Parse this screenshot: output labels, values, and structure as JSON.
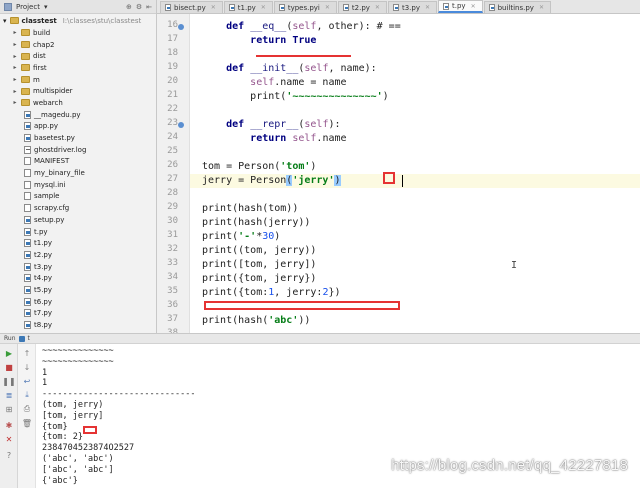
{
  "project": {
    "header_label": "Project",
    "root_name": "classtest",
    "root_path": "I:\\classes\\stu\\classtest",
    "items": [
      {
        "label": "build",
        "type": "folder"
      },
      {
        "label": "chap2",
        "type": "folder"
      },
      {
        "label": "dist",
        "type": "folder"
      },
      {
        "label": "first",
        "type": "folder"
      },
      {
        "label": "m",
        "type": "folder"
      },
      {
        "label": "multispider",
        "type": "folder"
      },
      {
        "label": "webarch",
        "type": "folder"
      },
      {
        "label": "__magedu.py",
        "type": "py"
      },
      {
        "label": "app.py",
        "type": "py"
      },
      {
        "label": "basetest.py",
        "type": "py"
      },
      {
        "label": "ghostdriver.log",
        "type": "log"
      },
      {
        "label": "MANIFEST",
        "type": "file"
      },
      {
        "label": "my_binary_file",
        "type": "file"
      },
      {
        "label": "mysql.ini",
        "type": "file"
      },
      {
        "label": "sample",
        "type": "file"
      },
      {
        "label": "scrapy.cfg",
        "type": "file"
      },
      {
        "label": "setup.py",
        "type": "py"
      },
      {
        "label": "t.py",
        "type": "py"
      },
      {
        "label": "t1.py",
        "type": "py"
      },
      {
        "label": "t2.py",
        "type": "py"
      },
      {
        "label": "t3.py",
        "type": "py"
      },
      {
        "label": "t4.py",
        "type": "py"
      },
      {
        "label": "t5.py",
        "type": "py"
      },
      {
        "label": "t6.py",
        "type": "py"
      },
      {
        "label": "t7.py",
        "type": "py"
      },
      {
        "label": "t8.py",
        "type": "py"
      }
    ]
  },
  "tabs": [
    {
      "label": "bisect.py",
      "active": false
    },
    {
      "label": "t1.py",
      "active": false
    },
    {
      "label": "types.pyi",
      "active": false
    },
    {
      "label": "t2.py",
      "active": false
    },
    {
      "label": "t3.py",
      "active": false
    },
    {
      "label": "t.py",
      "active": true
    },
    {
      "label": "builtins.py",
      "active": false
    }
  ],
  "editor": {
    "line_numbers": [
      "16",
      "17",
      "18",
      "19",
      "20",
      "21",
      "22",
      "23",
      "24",
      "25",
      "26",
      "27",
      "28",
      "29",
      "30",
      "31",
      "32",
      "33",
      "34",
      "35",
      "36",
      "37",
      "38"
    ],
    "lines": [
      [
        {
          "t": "    ",
          "c": "plain"
        },
        {
          "t": "def ",
          "c": "kw"
        },
        {
          "t": "__eq__",
          "c": "fn"
        },
        {
          "t": "(",
          "c": "plain"
        },
        {
          "t": "self",
          "c": "self"
        },
        {
          "t": ", other): # ==",
          "c": "plain"
        }
      ],
      [
        {
          "t": "        ",
          "c": "plain"
        },
        {
          "t": "return ",
          "c": "kw"
        },
        {
          "t": "True",
          "c": "kw"
        }
      ],
      [
        {
          "t": "",
          "c": "plain"
        }
      ],
      [
        {
          "t": "    ",
          "c": "plain"
        },
        {
          "t": "def ",
          "c": "kw"
        },
        {
          "t": "__init__",
          "c": "fn"
        },
        {
          "t": "(",
          "c": "plain"
        },
        {
          "t": "self",
          "c": "self"
        },
        {
          "t": ", name):",
          "c": "plain"
        }
      ],
      [
        {
          "t": "        ",
          "c": "plain"
        },
        {
          "t": "self",
          "c": "self"
        },
        {
          "t": ".name = name",
          "c": "plain"
        }
      ],
      [
        {
          "t": "        ",
          "c": "plain"
        },
        {
          "t": "print",
          "c": "plain"
        },
        {
          "t": "(",
          "c": "plain"
        },
        {
          "t": "'~~~~~~~~~~~~~~'",
          "c": "str"
        },
        {
          "t": ")",
          "c": "plain"
        }
      ],
      [
        {
          "t": "",
          "c": "plain"
        }
      ],
      [
        {
          "t": "    ",
          "c": "plain"
        },
        {
          "t": "def ",
          "c": "kw"
        },
        {
          "t": "__repr__",
          "c": "fn"
        },
        {
          "t": "(",
          "c": "plain"
        },
        {
          "t": "self",
          "c": "self"
        },
        {
          "t": "):",
          "c": "plain"
        }
      ],
      [
        {
          "t": "        ",
          "c": "plain"
        },
        {
          "t": "return ",
          "c": "kw"
        },
        {
          "t": "self",
          "c": "self"
        },
        {
          "t": ".name",
          "c": "plain"
        }
      ],
      [
        {
          "t": "",
          "c": "plain"
        }
      ],
      [
        {
          "t": "tom = Person(",
          "c": "plain"
        },
        {
          "t": "'tom'",
          "c": "str"
        },
        {
          "t": ")",
          "c": "plain"
        }
      ],
      [
        {
          "t": "jerry = Person",
          "c": "plain"
        },
        {
          "t": "(",
          "c": "paren-hl"
        },
        {
          "t": "'jerry'",
          "c": "str"
        },
        {
          "t": ")",
          "c": "paren-hl"
        }
      ],
      [
        {
          "t": "",
          "c": "plain"
        }
      ],
      [
        {
          "t": "print",
          "c": "plain"
        },
        {
          "t": "(hash(tom))",
          "c": "plain"
        }
      ],
      [
        {
          "t": "print",
          "c": "plain"
        },
        {
          "t": "(hash(jerry))",
          "c": "plain"
        }
      ],
      [
        {
          "t": "print",
          "c": "plain"
        },
        {
          "t": "(",
          "c": "plain"
        },
        {
          "t": "'-'",
          "c": "str"
        },
        {
          "t": "*",
          "c": "plain"
        },
        {
          "t": "30",
          "c": "num"
        },
        {
          "t": ")",
          "c": "plain"
        }
      ],
      [
        {
          "t": "print",
          "c": "plain"
        },
        {
          "t": "((tom, jerry))",
          "c": "plain"
        }
      ],
      [
        {
          "t": "print",
          "c": "plain"
        },
        {
          "t": "([tom, jerry])",
          "c": "plain"
        }
      ],
      [
        {
          "t": "print",
          "c": "plain"
        },
        {
          "t": "({tom, jerry})",
          "c": "plain"
        }
      ],
      [
        {
          "t": "print",
          "c": "plain"
        },
        {
          "t": "({tom:",
          "c": "plain"
        },
        {
          "t": "1",
          "c": "num"
        },
        {
          "t": ", jerry:",
          "c": "plain"
        },
        {
          "t": "2",
          "c": "num"
        },
        {
          "t": "})",
          "c": "plain"
        }
      ],
      [
        {
          "t": "",
          "c": "plain"
        }
      ],
      [
        {
          "t": "print",
          "c": "plain"
        },
        {
          "t": "(hash(",
          "c": "plain"
        },
        {
          "t": "'abc'",
          "c": "str"
        },
        {
          "t": "))",
          "c": "plain"
        }
      ],
      [
        {
          "t": "",
          "c": "plain"
        }
      ]
    ]
  },
  "run": {
    "header_label": "Run",
    "tab_label": "t",
    "output": [
      "~~~~~~~~~~~~~~",
      "~~~~~~~~~~~~~~",
      "1",
      "1",
      "------------------------------",
      "(tom, jerry)",
      "[tom, jerry]",
      "{tom}",
      "{tom: 2}",
      "2384704523874O2527",
      "('abc', 'abc')",
      "['abc', 'abc']",
      "{'abc'}"
    ]
  },
  "watermark": "https://blog.csdn.net/qq_42227818",
  "colors": {
    "keyword": "#000080",
    "string": "#067d17",
    "number": "#1750eb",
    "self": "#94558d",
    "annotation_red": "#e53333",
    "current_line": "#fcfae1",
    "active_tab_underline": "#4a8adb"
  }
}
